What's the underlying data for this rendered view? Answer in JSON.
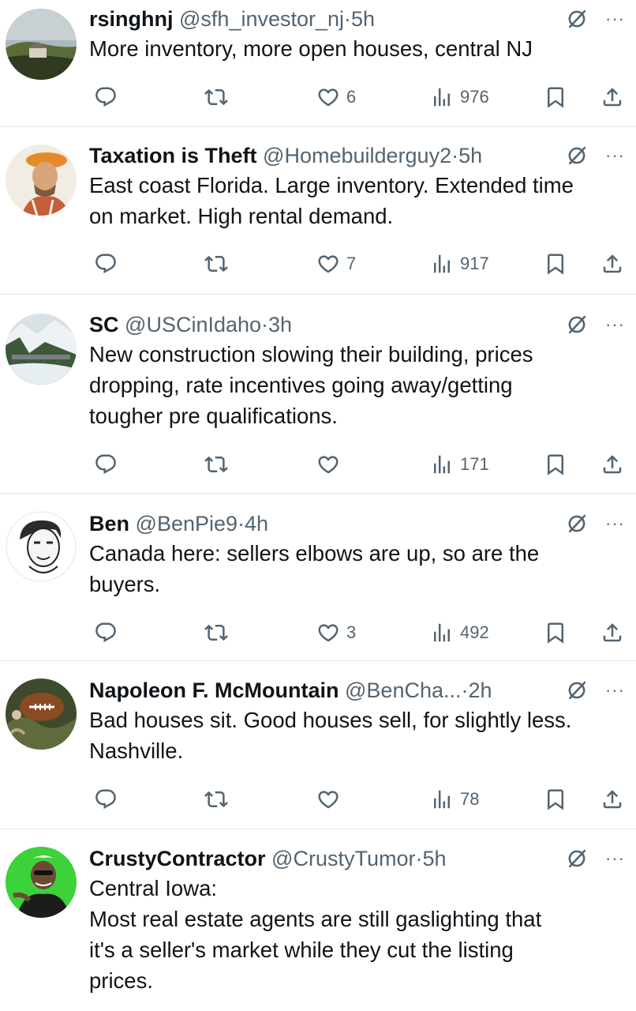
{
  "tweets": [
    {
      "name": "rsinghnj",
      "handle": "@sfh_investor_nj",
      "sep": "·",
      "time": "5h",
      "text": "More inventory, more open houses, central NJ",
      "likes": "6",
      "views": "976"
    },
    {
      "name": "Taxation is Theft",
      "handle": "@Homebuilderguy2",
      "sep": "·",
      "time": "5h",
      "text": "East coast Florida. Large inventory. Extended time\non market. High rental demand.",
      "likes": "7",
      "views": "917"
    },
    {
      "name": "SC",
      "handle": "@USCinIdaho",
      "sep": "·",
      "time": "3h",
      "text": "New construction slowing their building, prices\ndropping, rate incentives going away/getting\ntougher pre qualifications.",
      "likes": "",
      "views": "171"
    },
    {
      "name": "Ben",
      "handle": "@BenPie9",
      "sep": "·",
      "time": "4h",
      "text": "Canada here: sellers elbows are up, so are the\nbuyers.",
      "likes": "3",
      "views": "492"
    },
    {
      "name": "Napoleon F. McMountain",
      "handle": "@BenCha...",
      "sep": "·",
      "time": "2h",
      "text": "Bad houses sit. Good houses sell, for slightly less.\nNashville.",
      "likes": "",
      "views": "78"
    },
    {
      "name": "CrustyContractor",
      "handle": "@CrustyTumor",
      "sep": "·",
      "time": "5h",
      "text": "Central Iowa:\nMost real estate agents are still gaslighting that\nit's a seller's market while they cut the listing\nprices.",
      "likes": "",
      "views": ""
    }
  ],
  "icons": {
    "reply": "reply-icon",
    "retweet": "retweet-icon",
    "like": "heart-icon",
    "views": "views-bar-chart-icon",
    "bookmark": "bookmark-icon",
    "share": "share-icon",
    "grok": "grok-icon",
    "more": "more-icon"
  },
  "more_label": "···",
  "colors": {
    "text": "#0f1419",
    "secondary": "#536471",
    "divider": "#e4e8eb"
  }
}
